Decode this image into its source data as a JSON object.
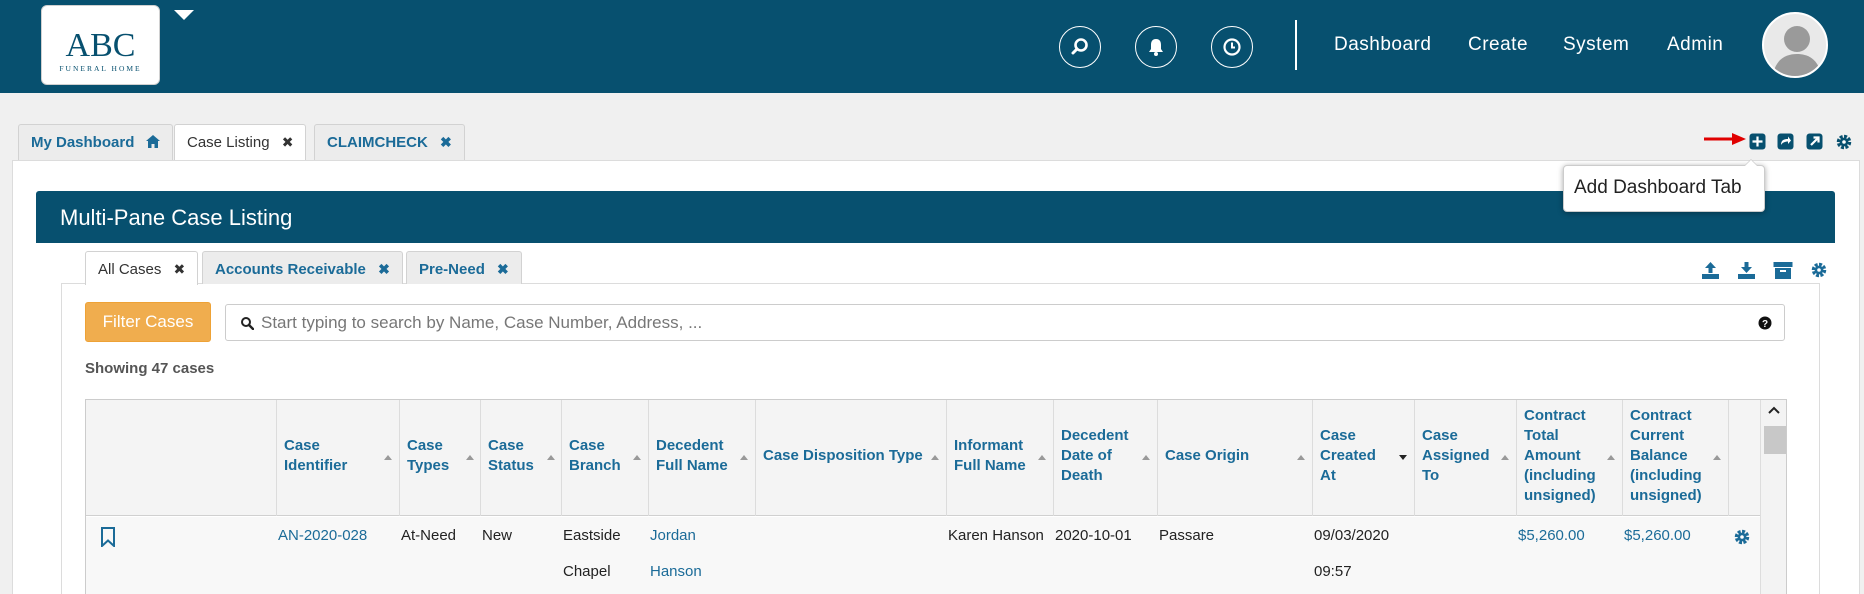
{
  "logo": {
    "main": "ABC",
    "sub": "FUNERAL HOME"
  },
  "nav": {
    "links": [
      "Dashboard",
      "Create",
      "System",
      "Admin"
    ]
  },
  "tabs": [
    {
      "label": "My Dashboard"
    },
    {
      "label": "Case Listing"
    },
    {
      "label": "CLAIMCHECK"
    }
  ],
  "tooltip": "Add Dashboard Tab",
  "panel": {
    "title": "Multi-Pane Case Listing"
  },
  "subtabs": [
    {
      "label": "All Cases"
    },
    {
      "label": "Accounts Receivable"
    },
    {
      "label": "Pre-Need"
    }
  ],
  "filter": {
    "label": "Filter Cases"
  },
  "search": {
    "placeholder": "Start typing to search by Name, Case Number, Address, ..."
  },
  "showing": "Showing 47 cases",
  "table": {
    "headers": [
      "Case Identifier",
      "Case Types",
      "Case Status",
      "Case Branch",
      "Decedent Full Name",
      "Case Disposition Type",
      "Informant Full Name",
      "Decedent Date of Death",
      "Case Origin",
      "Case Created At",
      "Case Assigned To",
      "Contract Total Amount (including unsigned)",
      "Contract Current Balance (including unsigned)"
    ],
    "rows": [
      {
        "case_identifier": "AN-2020-028",
        "case_types": "At-Need",
        "case_status": "New",
        "case_branch_1": "Eastside",
        "case_branch_2": "Chapel",
        "decedent_1": "Jordan",
        "decedent_2": "Hanson",
        "informant": "Karen Hanson",
        "date_of_death": "2020-10-01",
        "case_origin": "Passare",
        "created_1": "09/03/2020",
        "created_2": "09:57",
        "total_amount": "$5,260.00",
        "current_balance": "$5,260.00"
      }
    ]
  },
  "colors": {
    "navbar": "#07506f",
    "accent": "#1b6b98",
    "filter_button": "#f0ad4e",
    "arrow": "#e00000"
  }
}
